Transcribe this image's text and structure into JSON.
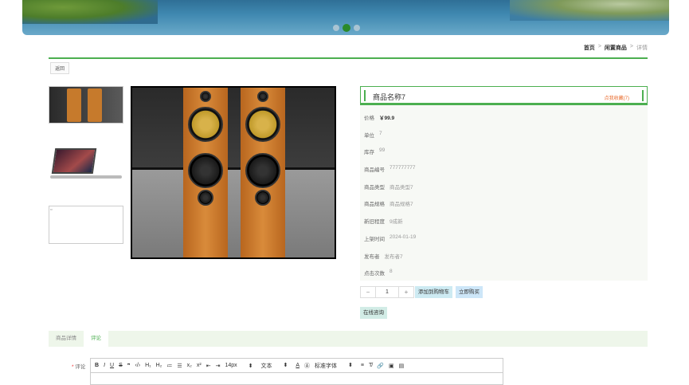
{
  "breadcrumb": {
    "home": "首页",
    "sep1": ">",
    "category": "闲置商品",
    "sep2": ">",
    "current": "详情"
  },
  "back_label": "返回",
  "product": {
    "name": "商品名称7",
    "favorite_label": "点我收藏(7)",
    "fields": [
      {
        "label": "价格",
        "value": "￥99.9"
      },
      {
        "label": "单位",
        "value": "7"
      },
      {
        "label": "库存",
        "value": "99"
      },
      {
        "label": "商品编号",
        "value": "777777777"
      },
      {
        "label": "商品类型",
        "value": "商品类型7"
      },
      {
        "label": "商品规格",
        "value": "商品规格7"
      },
      {
        "label": "新旧程度",
        "value": "9成新"
      },
      {
        "label": "上架时间",
        "value": "2024-01-19"
      },
      {
        "label": "发布者",
        "value": "发布者7"
      },
      {
        "label": "点击次数",
        "value": "8"
      }
    ]
  },
  "quantity": {
    "minus": "−",
    "value": "1",
    "plus": "+"
  },
  "buttons": {
    "add_cart": "添加到购物车",
    "buy_now": "立即购买",
    "consult": "在线咨询"
  },
  "tabs": [
    {
      "label": "商品详情"
    },
    {
      "label": "评论"
    }
  ],
  "editor": {
    "required_mark": "*",
    "label": "评论",
    "toolbar": [
      "B",
      "I",
      "U",
      "S",
      "❞",
      "‹/›",
      "H₁",
      "H₂",
      "≔",
      "☰",
      "x₂",
      "x²",
      "⇤",
      "⇥"
    ],
    "font_size": "14px",
    "text_style": "文本",
    "font_family": "标准字体",
    "toolbar_end": [
      "A",
      "Ⓐ",
      "≡",
      "T̸",
      "🔗",
      "▣",
      "▤"
    ]
  },
  "colors": {
    "accent": "#4caf50",
    "favorite": "#e86a2a"
  }
}
